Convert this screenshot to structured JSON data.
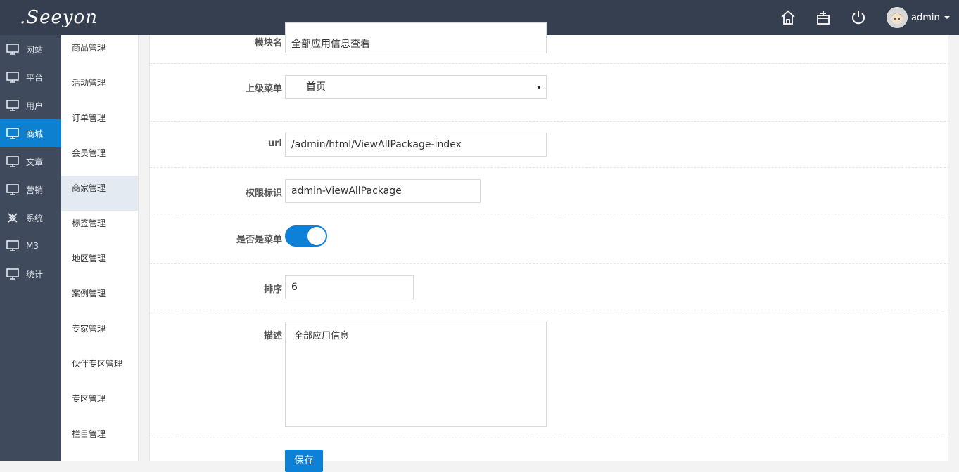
{
  "header": {
    "logo_text": ".Seeyon",
    "icons": [
      "home-icon",
      "gift-icon",
      "power-icon"
    ],
    "user_name": "admin"
  },
  "nav1": {
    "items": [
      {
        "label": "网站",
        "icon": "monitor-icon"
      },
      {
        "label": "平台",
        "icon": "monitor-icon"
      },
      {
        "label": "用户",
        "icon": "monitor-icon"
      },
      {
        "label": "商城",
        "icon": "monitor-icon",
        "active": true
      },
      {
        "label": "文章",
        "icon": "monitor-icon"
      },
      {
        "label": "营销",
        "icon": "monitor-icon"
      },
      {
        "label": "系统",
        "icon": "gear-icon"
      },
      {
        "label": "M3",
        "icon": "monitor-icon"
      },
      {
        "label": "统计",
        "icon": "monitor-icon"
      }
    ],
    "accent": "#0d80cf"
  },
  "nav2": {
    "items": [
      {
        "label": "商品管理"
      },
      {
        "label": "活动管理"
      },
      {
        "label": "订单管理"
      },
      {
        "label": "会员管理"
      },
      {
        "label": "商家管理",
        "active": true
      },
      {
        "label": "标签管理"
      },
      {
        "label": "地区管理"
      },
      {
        "label": "案例管理"
      },
      {
        "label": "专家管理"
      },
      {
        "label": "伙伴专区管理"
      },
      {
        "label": "专区管理"
      },
      {
        "label": "栏目管理"
      }
    ]
  },
  "form": {
    "module_name": {
      "label": "模块名",
      "value": "全部应用信息查看"
    },
    "parent_menu": {
      "label": "上级菜单",
      "value": "首页"
    },
    "url": {
      "label": "url",
      "value": "/admin/html/ViewAllPackage-index"
    },
    "permission": {
      "label": "权限标识",
      "value": "admin-ViewAllPackage"
    },
    "is_menu": {
      "label": "是否是菜单",
      "checked": true
    },
    "sort": {
      "label": "排序",
      "value": "6"
    },
    "description": {
      "label": "描述",
      "value": "全部应用信息"
    },
    "save_label": "保存"
  }
}
